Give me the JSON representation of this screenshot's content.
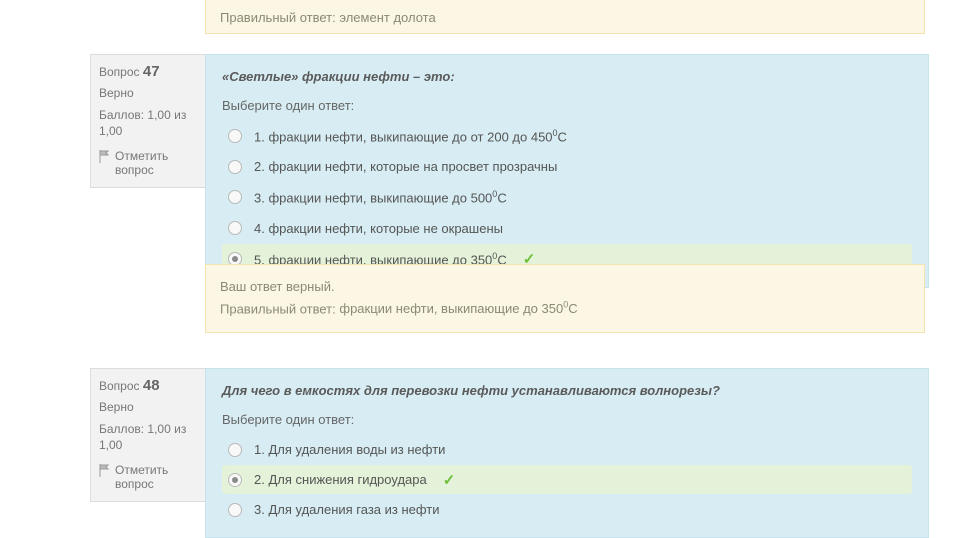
{
  "labels": {
    "question_word": "Вопрос",
    "score_prefix": "Баллов:",
    "score_value": "1,00",
    "score_of": "из",
    "score_max": "1,00",
    "flag": "Отметить вопрос",
    "prompt": "Выберите один ответ:",
    "correct_msg": "Ваш ответ верный.",
    "correct_prefix": "Правильный ответ:"
  },
  "prev_feedback": {
    "answer": "элемент долота"
  },
  "q47": {
    "number": "47",
    "state": "Верно",
    "text": "«Светлые» фракции нефти – это:",
    "options": [
      {
        "n": "1.",
        "label_a": "фракции нефти, выкипающие до от 200 до 450",
        "sup": "0",
        "label_b": "С"
      },
      {
        "n": "2.",
        "label_a": "фракции нефти, которые на просвет прозрачны",
        "sup": "",
        "label_b": ""
      },
      {
        "n": "3.",
        "label_a": "фракции нефти, выкипающие до 500",
        "sup": "0",
        "label_b": "С"
      },
      {
        "n": "4.",
        "label_a": "фракции нефти, которые не окрашены",
        "sup": "",
        "label_b": ""
      },
      {
        "n": "5.",
        "label_a": "фракции нефти, выкипающие до 350",
        "sup": "0",
        "label_b": "С"
      }
    ],
    "selected_index": 4,
    "correct_answer_a": "фракции нефти, выкипающие до 350",
    "correct_answer_sup": "0",
    "correct_answer_b": "С"
  },
  "q48": {
    "number": "48",
    "state": "Верно",
    "text": "Для чего в емкостях для перевозки нефти устанавливаются волнорезы?",
    "options": [
      {
        "n": "1.",
        "label_a": "Для удаления воды из нефти",
        "sup": "",
        "label_b": ""
      },
      {
        "n": "2.",
        "label_a": "Для снижения гидроудара",
        "sup": "",
        "label_b": ""
      },
      {
        "n": "3.",
        "label_a": "Для удаления газа из нефти",
        "sup": "",
        "label_b": ""
      }
    ],
    "selected_index": 1
  }
}
